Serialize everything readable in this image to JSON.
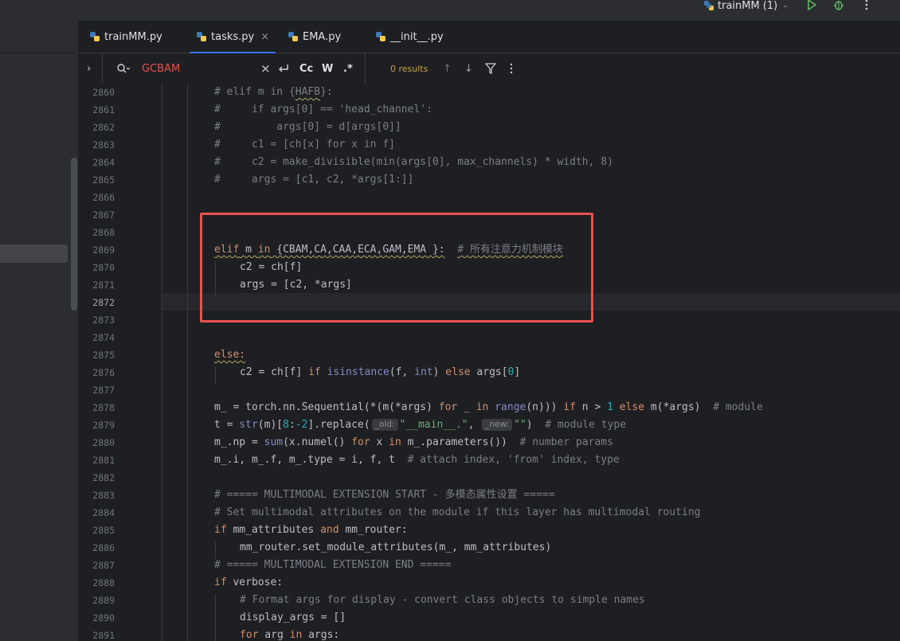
{
  "run": {
    "config": "trainMM (1)"
  },
  "tabs": [
    {
      "label": "trainMM.py",
      "active": false
    },
    {
      "label": "tasks.py",
      "active": true
    },
    {
      "label": "EMA.py",
      "active": false
    },
    {
      "label": "__init__.py",
      "active": false
    }
  ],
  "find": {
    "query": "GCBAM",
    "results": "0 results",
    "match_case": "Cc",
    "words": "W",
    "regex": ".*"
  },
  "editor": {
    "current_line": "2872",
    "line_numbers": [
      "2860",
      "2861",
      "2862",
      "2863",
      "2864",
      "2865",
      "2866",
      "2867",
      "2868",
      "2869",
      "2870",
      "2871",
      "2872",
      "2873",
      "2874",
      "2875",
      "2876",
      "2877",
      "2878",
      "2879",
      "2880",
      "2881",
      "2882",
      "2883",
      "2884",
      "2885",
      "2886",
      "2887",
      "2888",
      "2889",
      "2890",
      "2891"
    ],
    "hints": {
      "old": "_old:",
      "new": "_new:"
    },
    "text": {
      "l2860a": "# elif m in {",
      "l2860b": "HAFB",
      "l2860c": "}:",
      "l2861": "#     if args[0] == 'head_channel':",
      "l2862": "#         args[0] = d[args[0]]",
      "l2863": "#     c1 = [ch[x] for x in f]",
      "l2864": "#     c2 = make_divisible(min(args[0], max_channels) * width, 8)",
      "l2865": "#     args = [c1, c2, *args[1:]]",
      "l2869_code": "elif m in {CBAM,CA,CAA,ECA,GAM,EMA }:",
      "l2869_comment": "# 所有注意力机制模块",
      "l2870": "c2 = ch[f]",
      "l2871": "args = [c2, *args]",
      "l2875": "else:",
      "l2876a": "c2 = ch[f] ",
      "l2876b": "if",
      "l2876c": " isinstance",
      "l2876d": "(f, ",
      "l2876e": "int",
      "l2876f": ") ",
      "l2876g": "else",
      "l2876h": " args[",
      "l2876i": "0",
      "l2876j": "]",
      "l2878a": "m_ = torch.nn.Sequential(*(m(*args) ",
      "l2878b": "for",
      "l2878c": " _ ",
      "l2878d": "in",
      "l2878e": " range",
      "l2878f": "(n))) ",
      "l2878g": "if",
      "l2878h": " n > ",
      "l2878i": "1",
      "l2878j": " else",
      "l2878k": " m(*args)  ",
      "l2878l": "# module",
      "l2879a": "t = ",
      "l2879b": "str",
      "l2879c": "(m)[",
      "l2879d": "8",
      "l2879e": ":",
      "l2879f": "-2",
      "l2879g": "].replace(",
      "l2879h": "\"__main__.\"",
      "l2879i": ", ",
      "l2879j": "\"\"",
      "l2879k": ")  ",
      "l2879l": "# module type",
      "l2880a": "m_.np = ",
      "l2880b": "sum",
      "l2880c": "(x.numel() ",
      "l2880d": "for",
      "l2880e": " x ",
      "l2880f": "in",
      "l2880g": " m_.parameters())  ",
      "l2880h": "# number params",
      "l2881a": "m_.i, m_.f, m_.type = i, f, t  ",
      "l2881b": "# attach index, 'from' index, type",
      "l2883": "# ===== MULTIMODAL EXTENSION START - 多模态属性设置 =====",
      "l2884": "# Set multimodal attributes on the module if this layer has multimodal routing",
      "l2885a": "if",
      "l2885b": " mm_attributes ",
      "l2885c": "and",
      "l2885d": " mm_router:",
      "l2886": "mm_router.set_module_attributes(m_, mm_attributes)",
      "l2887": "# ===== MULTIMODAL EXTENSION END =====",
      "l2888a": "if",
      "l2888b": " verbose:",
      "l2889": "# Format args for display - convert class objects to simple names",
      "l2890": "display_args = []",
      "l2891a": "for",
      "l2891b": " arg ",
      "l2891c": "in",
      "l2891d": " args:"
    }
  },
  "colors": {
    "accent": "#3574f0",
    "annotation": "#e8524c",
    "search_query": "#e8524c",
    "results": "#8a6f2c"
  }
}
